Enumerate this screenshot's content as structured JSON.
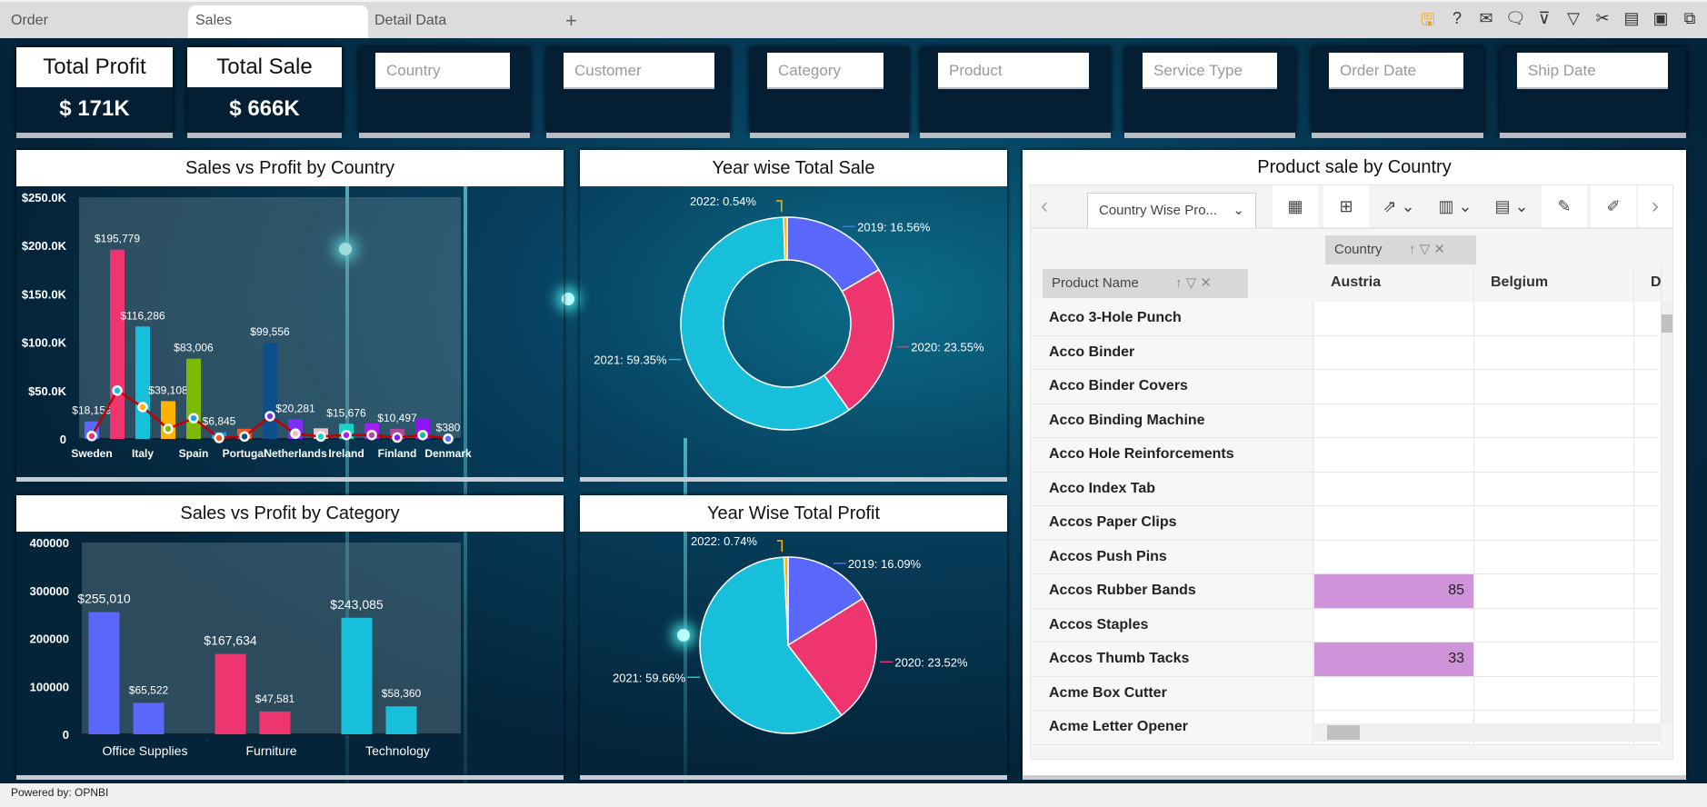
{
  "tabs": [
    {
      "label": "Order"
    },
    {
      "label": "Sales"
    },
    {
      "label": "Detail Data"
    }
  ],
  "add_tab": "+",
  "toolbar_icons": [
    "save-icon",
    "help-icon",
    "mail-icon",
    "comment-icon",
    "clear-filter-icon",
    "filter-icon",
    "tools-icon",
    "table-icon",
    "screen-icon",
    "devices-icon"
  ],
  "kpis": [
    {
      "title": "Total Profit",
      "value": "$ 171K"
    },
    {
      "title": "Total Sale",
      "value": "$ 666K"
    }
  ],
  "filters": [
    {
      "placeholder": "Country"
    },
    {
      "placeholder": "Customer"
    },
    {
      "placeholder": "Category"
    },
    {
      "placeholder": "Product"
    },
    {
      "placeholder": "Service Type"
    },
    {
      "placeholder": "Order Date"
    },
    {
      "placeholder": "Ship Date"
    }
  ],
  "footer": "Powered by: OPNBI",
  "chart_data": [
    {
      "type": "bar",
      "title": "Sales vs Profit by Country",
      "categories": [
        "Sweden",
        "",
        "Italy",
        "",
        "Spain",
        "",
        "Portugal",
        "",
        "Netherlands",
        "",
        "Ireland",
        "",
        "Finland",
        "",
        "Denmark"
      ],
      "series": [
        {
          "values": [
            18159,
            195779,
            116286,
            39108,
            83006,
            6845,
            10500,
            99556,
            20281,
            11000,
            15676,
            16000,
            10497,
            21000,
            380
          ],
          "labels": [
            "$18,159",
            "$195,779",
            "$116,286",
            "$39,108",
            "$83,006",
            "$6,845",
            "",
            "$99,556",
            "$20,281",
            "",
            "$15,676",
            "",
            "$10,497",
            "",
            "$380"
          ],
          "colors": [
            "#5a67fb",
            "#ef3570",
            "#17bfdb",
            "#ffb300",
            "#7cb900",
            "#1e9be6",
            "#f15a22",
            "#0d4f8b",
            "#7b2ff7",
            "#e8c1cb",
            "#17d4c8",
            "#a31ff7",
            "#b7479e",
            "#9013fe",
            "#1abc9c"
          ]
        },
        {
          "type": "line",
          "color": "#c00000",
          "values": [
            3000,
            50000,
            33000,
            10500,
            21500,
            1000,
            2500,
            23500,
            5500,
            2500,
            4000,
            4000,
            1500,
            4000,
            200
          ]
        }
      ],
      "yticks": [
        "0",
        "$50.0K",
        "$100.0K",
        "$150.0K",
        "$200.0K",
        "$250.0K"
      ],
      "ylim": [
        0,
        250000
      ]
    },
    {
      "type": "pie",
      "title": "Year wise Total Sale",
      "donut": true,
      "slices": [
        {
          "label": "2019: 16.56%",
          "value": 16.56,
          "color": "#5a67fb"
        },
        {
          "label": "2020: 23.55%",
          "value": 23.55,
          "color": "#ef3570"
        },
        {
          "label": "2021: 59.35%",
          "value": 59.35,
          "color": "#17bfdb"
        },
        {
          "label": "2022: 0.54%",
          "value": 0.54,
          "color": "#ffb300"
        }
      ]
    },
    {
      "type": "bar",
      "title": "Sales vs Profit by Category",
      "categories": [
        "Office Supplies",
        "Furniture",
        "Technology"
      ],
      "series": [
        {
          "values": [
            255010,
            167634,
            243085
          ],
          "labels": [
            "$255,010",
            "$167,634",
            "$243,085"
          ]
        },
        {
          "values": [
            65522,
            47581,
            58360
          ],
          "labels": [
            "$65,522",
            "$47,581",
            "$58,360"
          ]
        }
      ],
      "colors": [
        "#5a67fb",
        "#ef3570",
        "#17bfdb"
      ],
      "yticks": [
        "0",
        "100000",
        "200000",
        "300000",
        "400000"
      ],
      "ylim": [
        0,
        400000
      ]
    },
    {
      "type": "pie",
      "title": "Year Wise Total Profit",
      "donut": false,
      "slices": [
        {
          "label": "2019: 16.09%",
          "value": 16.09,
          "color": "#5a67fb"
        },
        {
          "label": "2020: 23.52%",
          "value": 23.52,
          "color": "#ef3570"
        },
        {
          "label": "2021: 59.66%",
          "value": 59.66,
          "color": "#17bfdb"
        },
        {
          "label": "2022: 0.74%",
          "value": 0.74,
          "color": "#ffb300"
        }
      ]
    }
  ],
  "pivot": {
    "title": "Product sale by Country",
    "report_select": "Country Wise Pro...",
    "column_chip": "Country",
    "row_chip": "Product Name",
    "columns": [
      "Austria",
      "Belgium",
      "D"
    ],
    "rows": [
      {
        "name": "Acco 3-Hole Punch",
        "austria": ""
      },
      {
        "name": "Acco Binder",
        "austria": ""
      },
      {
        "name": "Acco Binder Covers",
        "austria": ""
      },
      {
        "name": "Acco Binding Machine",
        "austria": ""
      },
      {
        "name": "Acco Hole Reinforcements",
        "austria": ""
      },
      {
        "name": "Acco Index Tab",
        "austria": ""
      },
      {
        "name": "Accos Paper Clips",
        "austria": ""
      },
      {
        "name": "Accos Push Pins",
        "austria": ""
      },
      {
        "name": "Accos Rubber Bands",
        "austria": "85"
      },
      {
        "name": "Accos Staples",
        "austria": ""
      },
      {
        "name": "Accos Thumb Tacks",
        "austria": "33"
      },
      {
        "name": "Acme Box Cutter",
        "austria": ""
      },
      {
        "name": "Acme Letter Opener",
        "austria": ""
      }
    ],
    "highlight_color": "#ce93d8"
  }
}
